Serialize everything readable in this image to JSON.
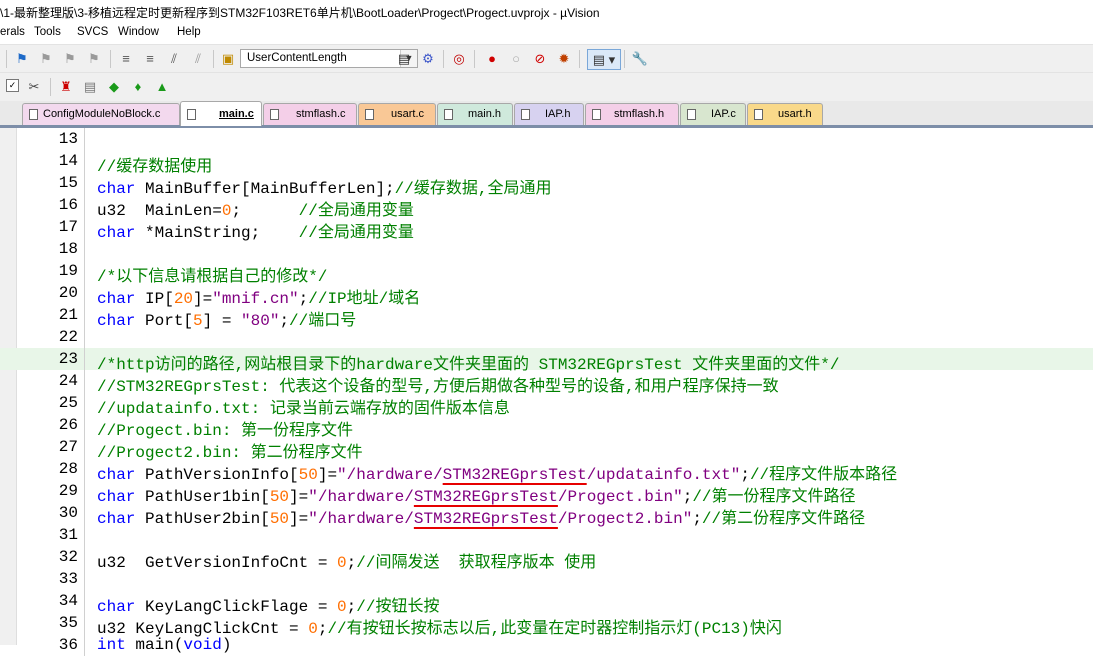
{
  "window": {
    "title": "\\1-最新整理版\\3-移植远程定时更新程序到STM32F103RET6单片机\\BootLoader\\Progect\\Progect.uvprojx - µVision"
  },
  "menu": [
    "erals",
    "Tools",
    "SVCS",
    "Window",
    "Help"
  ],
  "toolbar": {
    "combo_value": "UserContentLength",
    "icons": [
      "bookmark-icon",
      "prev-bookmark-icon",
      "next-bookmark-icon",
      "clear-bookmarks-icon",
      "indent-icon",
      "unindent-icon",
      "comment-icon",
      "uncomment-icon",
      "find-in-files-icon",
      "find-icon",
      "incremental-find-icon",
      "debug-session-icon",
      "breakpoint-icon",
      "disable-breakpoint-icon",
      "kill-breakpoints-icon",
      "kill-all-breakpoints-icon",
      "window-layout-icon",
      "configure-icon"
    ]
  },
  "toolbar2": {
    "icons": [
      "target-options-icon",
      "load-icon",
      "build-icon",
      "rebuild-icon",
      "batch-build-icon",
      "stop-build-icon",
      "manage-project-icon"
    ]
  },
  "tabs": [
    {
      "label": "ConfigModuleNoBlock.c",
      "color": "#f3d9ee",
      "active": false
    },
    {
      "label": "main.c",
      "color": "#ffffff",
      "active": true
    },
    {
      "label": "stmflash.c",
      "color": "#f4cfe8",
      "active": false
    },
    {
      "label": "usart.c",
      "color": "#f9c896",
      "active": false
    },
    {
      "label": "main.h",
      "color": "#cfe9dc",
      "active": false
    },
    {
      "label": "IAP.h",
      "color": "#d7d2f0",
      "active": false
    },
    {
      "label": "stmflash.h",
      "color": "#f4cfe8",
      "active": false
    },
    {
      "label": "IAP.c",
      "color": "#d8e6cf",
      "active": false
    },
    {
      "label": "usart.h",
      "color": "#f9d98a",
      "active": false
    }
  ],
  "code_lines": [
    {
      "n": "13",
      "parts": []
    },
    {
      "n": "14",
      "parts": [
        {
          "c": "cm",
          "t": "//缓存数据使用"
        }
      ]
    },
    {
      "n": "15",
      "parts": [
        {
          "c": "kw",
          "t": "char"
        },
        {
          "c": "",
          "t": " MainBuffer[MainBufferLen];"
        },
        {
          "c": "cm",
          "t": "//缓存数据,全局通用"
        }
      ]
    },
    {
      "n": "16",
      "parts": [
        {
          "c": "",
          "t": "u32  MainLen="
        },
        {
          "c": "nm",
          "t": "0"
        },
        {
          "c": "",
          "t": ";      "
        },
        {
          "c": "cm",
          "t": "//全局通用变量"
        }
      ]
    },
    {
      "n": "17",
      "parts": [
        {
          "c": "kw",
          "t": "char"
        },
        {
          "c": "",
          "t": " *MainString;    "
        },
        {
          "c": "cm",
          "t": "//全局通用变量"
        }
      ]
    },
    {
      "n": "18",
      "parts": []
    },
    {
      "n": "19",
      "parts": [
        {
          "c": "cm",
          "t": "/*以下信息请根据自己的修改*/"
        }
      ]
    },
    {
      "n": "20",
      "parts": [
        {
          "c": "kw",
          "t": "char"
        },
        {
          "c": "",
          "t": " IP["
        },
        {
          "c": "nm",
          "t": "20"
        },
        {
          "c": "",
          "t": "]="
        },
        {
          "c": "st",
          "t": "\"mnif.cn\""
        },
        {
          "c": "",
          "t": ";"
        },
        {
          "c": "cm",
          "t": "//IP地址/域名"
        }
      ]
    },
    {
      "n": "21",
      "parts": [
        {
          "c": "kw",
          "t": "char"
        },
        {
          "c": "",
          "t": " Port["
        },
        {
          "c": "nm",
          "t": "5"
        },
        {
          "c": "",
          "t": "] = "
        },
        {
          "c": "st",
          "t": "\"80\""
        },
        {
          "c": "",
          "t": ";"
        },
        {
          "c": "cm",
          "t": "//端口号"
        }
      ]
    },
    {
      "n": "22",
      "parts": []
    },
    {
      "n": "23",
      "hl": true,
      "parts": [
        {
          "c": "cm",
          "t": "/*http访问的路径,网站根目录下的hardware文件夹里面的 STM32REGprsTest 文件夹里面的文件*/"
        }
      ]
    },
    {
      "n": "24",
      "parts": [
        {
          "c": "cm",
          "t": "//STM32REGprsTest: 代表这个设备的型号,方便后期做各种型号的设备,和用户程序保持一致"
        }
      ]
    },
    {
      "n": "25",
      "parts": [
        {
          "c": "cm",
          "t": "//updatainfo.txt: 记录当前云端存放的固件版本信息"
        }
      ]
    },
    {
      "n": "26",
      "parts": [
        {
          "c": "cm",
          "t": "//Progect.bin: 第一份程序文件"
        }
      ]
    },
    {
      "n": "27",
      "parts": [
        {
          "c": "cm",
          "t": "//Progect2.bin: 第二份程序文件"
        }
      ]
    },
    {
      "n": "28",
      "parts": [
        {
          "c": "kw",
          "t": "char"
        },
        {
          "c": "",
          "t": " PathVersionInfo["
        },
        {
          "c": "nm",
          "t": "50"
        },
        {
          "c": "",
          "t": "]="
        },
        {
          "c": "st",
          "t": "\"/hardware/"
        },
        {
          "c": "st ul",
          "t": "STM32REGprsTest"
        },
        {
          "c": "st",
          "t": "/updatainfo.txt\""
        },
        {
          "c": "",
          "t": ";"
        },
        {
          "c": "cm",
          "t": "//程序文件版本路径"
        }
      ]
    },
    {
      "n": "29",
      "parts": [
        {
          "c": "kw",
          "t": "char"
        },
        {
          "c": "",
          "t": " PathUser1bin["
        },
        {
          "c": "nm",
          "t": "50"
        },
        {
          "c": "",
          "t": "]="
        },
        {
          "c": "st",
          "t": "\"/hardware/"
        },
        {
          "c": "st ul",
          "t": "STM32REGprsTest"
        },
        {
          "c": "st",
          "t": "/Progect.bin\""
        },
        {
          "c": "",
          "t": ";"
        },
        {
          "c": "cm",
          "t": "//第一份程序文件路径"
        }
      ]
    },
    {
      "n": "30",
      "parts": [
        {
          "c": "kw",
          "t": "char"
        },
        {
          "c": "",
          "t": " PathUser2bin["
        },
        {
          "c": "nm",
          "t": "50"
        },
        {
          "c": "",
          "t": "]="
        },
        {
          "c": "st",
          "t": "\"/hardware/"
        },
        {
          "c": "st ul",
          "t": "STM32REGprsTest"
        },
        {
          "c": "st",
          "t": "/Progect2.bin\""
        },
        {
          "c": "",
          "t": ";"
        },
        {
          "c": "cm",
          "t": "//第二份程序文件路径"
        }
      ]
    },
    {
      "n": "31",
      "parts": []
    },
    {
      "n": "32",
      "parts": [
        {
          "c": "",
          "t": "u32  GetVersionInfoCnt = "
        },
        {
          "c": "nm",
          "t": "0"
        },
        {
          "c": "",
          "t": ";"
        },
        {
          "c": "cm",
          "t": "//间隔发送  获取程序版本 使用"
        }
      ]
    },
    {
      "n": "33",
      "parts": []
    },
    {
      "n": "34",
      "parts": [
        {
          "c": "kw",
          "t": "char"
        },
        {
          "c": "",
          "t": " KeyLangClickFlage = "
        },
        {
          "c": "nm",
          "t": "0"
        },
        {
          "c": "",
          "t": ";"
        },
        {
          "c": "cm",
          "t": "//按钮长按"
        }
      ]
    },
    {
      "n": "35",
      "parts": [
        {
          "c": "",
          "t": "u32 KeyLangClickCnt = "
        },
        {
          "c": "nm",
          "t": "0"
        },
        {
          "c": "",
          "t": ";"
        },
        {
          "c": "cm",
          "t": "//有按钮长按标志以后,此变量在定时器控制指示灯(PC13)快闪"
        }
      ]
    },
    {
      "n": "36",
      "parts": [
        {
          "c": "kw",
          "t": "int"
        },
        {
          "c": "",
          "t": " main("
        },
        {
          "c": "kw",
          "t": "void"
        },
        {
          "c": "",
          "t": ")"
        }
      ]
    }
  ]
}
